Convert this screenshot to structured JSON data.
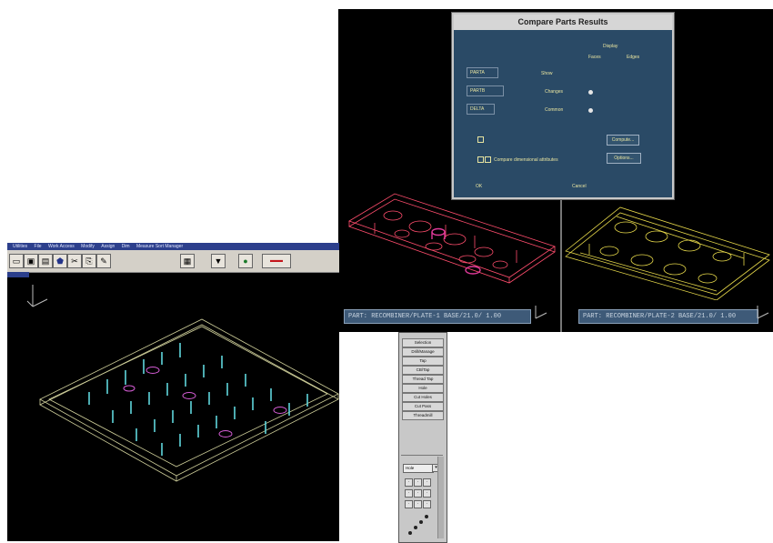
{
  "compare_dialog": {
    "title": "Compare Parts Results",
    "header_labels": [
      "Display",
      "Faces",
      "Edges"
    ],
    "field_values": [
      "PARTA",
      "PARTB",
      "DELTA"
    ],
    "options": [
      "Show",
      "Changes",
      "Common"
    ],
    "buttons": [
      "Compute...",
      "Options..."
    ],
    "compare_label": "Compare dimensional attributes",
    "footer": [
      "OK",
      "Cancel"
    ]
  },
  "status_bars": {
    "left": "PART: RECOMBINER/PLATE-1 BASE/21.0/ 1.00",
    "right": "PART: RECOMBINER/PLATE-2 BASE/21.0/ 1.00"
  },
  "app": {
    "menu": [
      "Utilities",
      "File",
      "Work Access",
      "Modify",
      "Assign",
      "Dim",
      "Measure Sort Manager"
    ],
    "toolbar_icons": [
      "open-icon",
      "save-icon",
      "print-icon",
      "shield-icon",
      "cut-icon",
      "copy-icon",
      "note-icon",
      "chart-icon",
      "funnel-icon",
      "person-icon",
      "logo-icon"
    ]
  },
  "command_panel": {
    "items": [
      "Selection",
      "Drill/Manage",
      "Tap",
      "CB/Tap",
      "Thread Tap",
      "Hole",
      "Cut Holes",
      "Cut Pass",
      "Threadmill"
    ],
    "dropdown": "Hole"
  },
  "colors": {
    "viewport_bg": "#000000",
    "dialog_bg": "#2a4a66",
    "dialog_text": "#e8e4a0",
    "wireframe_left": "#ff4d6d",
    "wireframe_right": "#e6d84a",
    "plate_edges": "#cfcf9a",
    "hole_cyan": "#5fd6dc",
    "hole_magenta": "#d45cd4"
  }
}
